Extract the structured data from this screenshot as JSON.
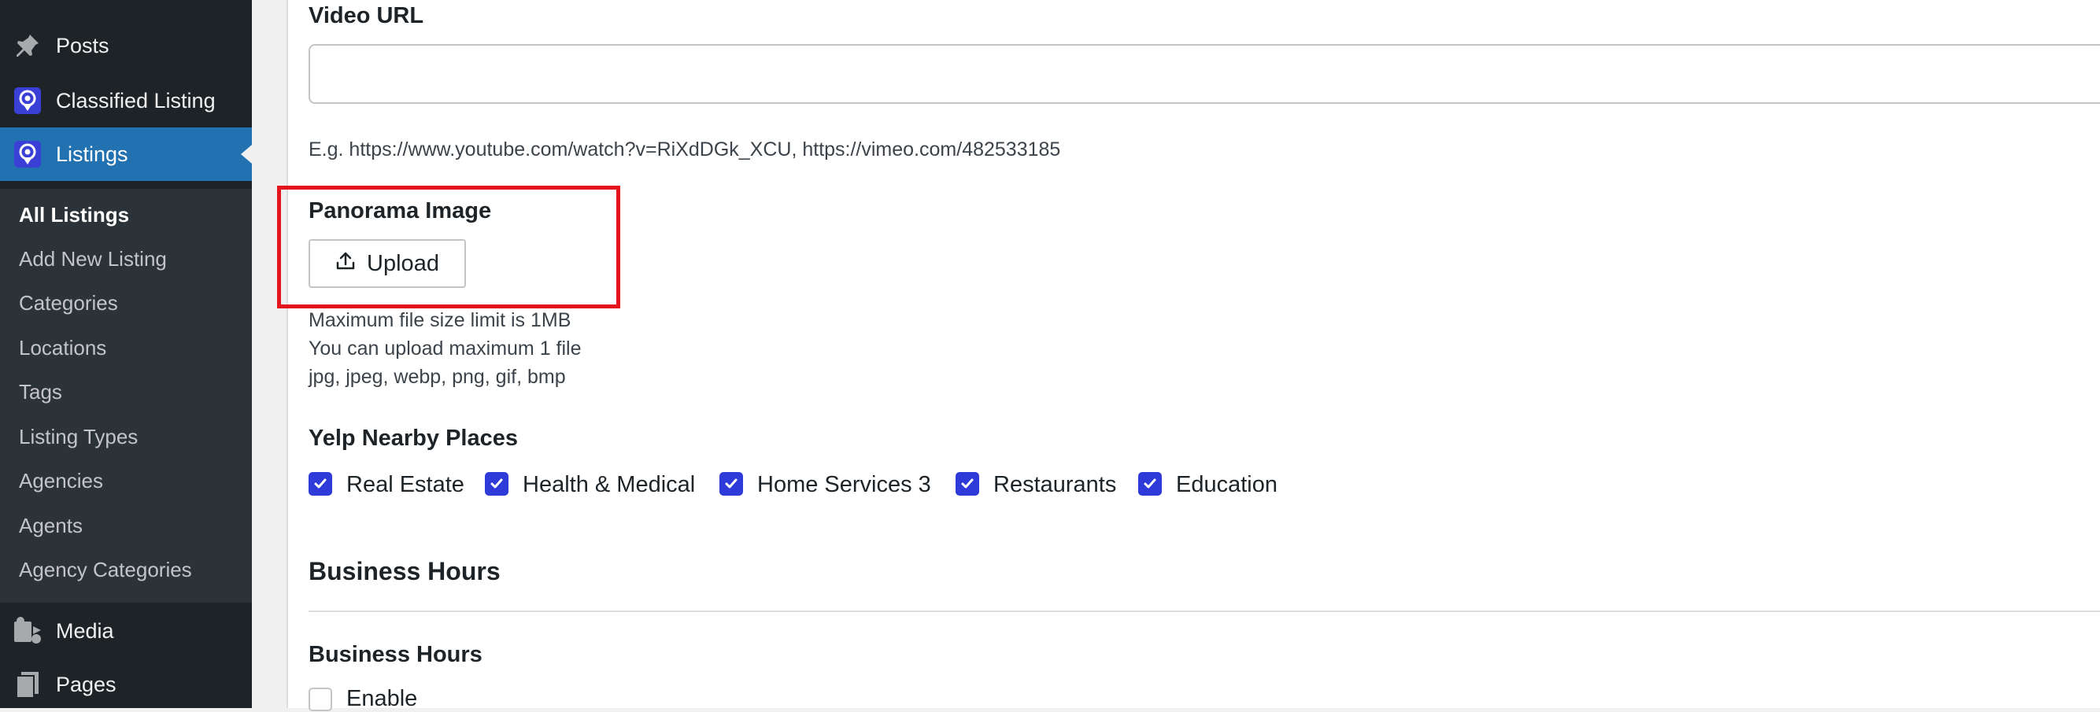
{
  "sidebar": {
    "menu": [
      {
        "label": "Posts",
        "icon": "pushpin-icon"
      },
      {
        "label": "Classified Listing",
        "icon": "classified-listing-icon"
      },
      {
        "label": "Listings",
        "icon": "listings-icon"
      }
    ],
    "submenu": [
      "All Listings",
      "Add New Listing",
      "Categories",
      "Locations",
      "Tags",
      "Listing Types",
      "Agencies",
      "Agents",
      "Agency Categories"
    ],
    "menu_bottom": [
      {
        "label": "Media",
        "icon": "media-icon"
      },
      {
        "label": "Pages",
        "icon": "pages-icon"
      }
    ]
  },
  "form": {
    "video_url": {
      "label": "Video URL",
      "value": "",
      "help": "E.g. https://www.youtube.com/watch?v=RiXdDGk_XCU, https://vimeo.com/482533185"
    },
    "panorama": {
      "label": "Panorama Image",
      "upload_label": "Upload",
      "notes": [
        "Maximum file size limit is 1MB",
        "You can upload maximum 1 file",
        "jpg, jpeg, webp, png, gif, bmp"
      ]
    },
    "yelp": {
      "label": "Yelp Nearby Places",
      "options": [
        {
          "label": "Real Estate",
          "checked": true
        },
        {
          "label": "Health & Medical",
          "checked": true
        },
        {
          "label": "Home Services 3",
          "checked": true
        },
        {
          "label": "Restaurants",
          "checked": true
        },
        {
          "label": "Education",
          "checked": true
        }
      ]
    },
    "business_hours_section": "Business Hours",
    "business_hours": {
      "label": "Business Hours",
      "enable_label": "Enable",
      "enabled": false
    }
  },
  "colors": {
    "sidebar_bg": "#1d2327",
    "submenu_bg": "#2c3338",
    "accent": "#2271b1",
    "checkbox": "#2f3bd9",
    "highlight": "#e5131b"
  }
}
